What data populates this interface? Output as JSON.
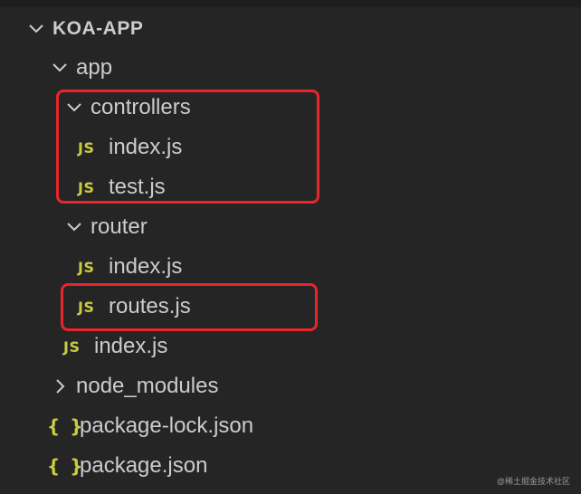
{
  "explorer": {
    "root_label": "KOA-APP",
    "items": [
      {
        "label": "app",
        "type": "folder",
        "expanded": true,
        "icon": "chevron-down-icon"
      },
      {
        "label": "controllers",
        "type": "folder",
        "expanded": true,
        "icon": "chevron-down-icon"
      },
      {
        "label": "index.js",
        "type": "file",
        "icon": "js-file-icon",
        "icon_text": "JS"
      },
      {
        "label": "test.js",
        "type": "file",
        "icon": "js-file-icon",
        "icon_text": "JS"
      },
      {
        "label": "router",
        "type": "folder",
        "expanded": true,
        "icon": "chevron-down-icon"
      },
      {
        "label": "index.js",
        "type": "file",
        "icon": "js-file-icon",
        "icon_text": "JS"
      },
      {
        "label": "routes.js",
        "type": "file",
        "icon": "js-file-icon",
        "icon_text": "JS"
      },
      {
        "label": "index.js",
        "type": "file",
        "icon": "js-file-icon",
        "icon_text": "JS"
      },
      {
        "label": "node_modules",
        "type": "folder",
        "expanded": false,
        "icon": "chevron-right-icon"
      },
      {
        "label": "package-lock.json",
        "type": "file",
        "icon": "json-file-icon",
        "icon_text": "{ }"
      },
      {
        "label": "package.json",
        "type": "file",
        "icon": "json-file-icon",
        "icon_text": "{ }"
      }
    ]
  },
  "watermark": "@稀土掘金技术社区",
  "colors": {
    "background": "#252526",
    "text": "#cccccc",
    "js_icon": "#cbcb41",
    "highlight": "#e8252b"
  }
}
